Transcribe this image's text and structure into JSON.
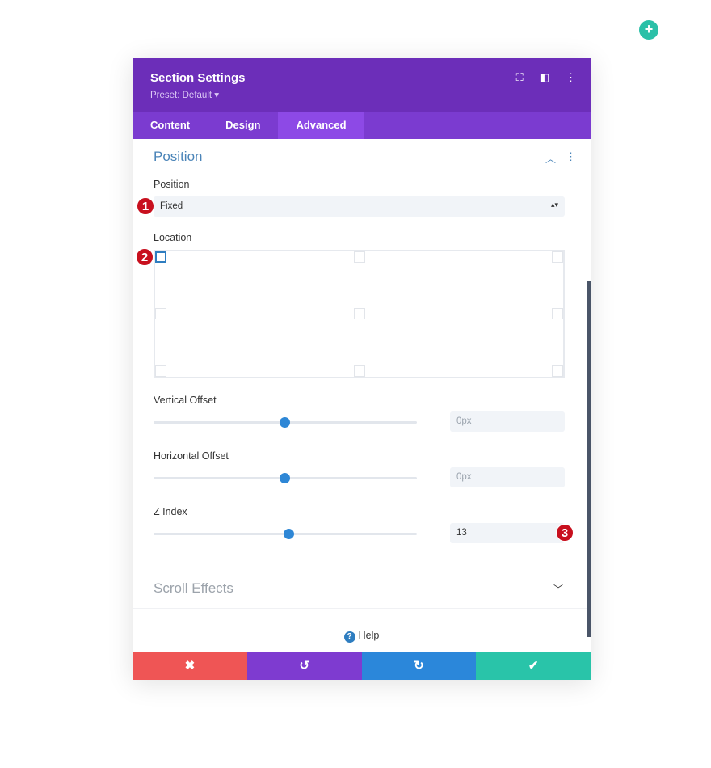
{
  "add_icon": "+",
  "header": {
    "title": "Section Settings",
    "preset": "Preset: Default ▾"
  },
  "tabs": [
    {
      "label": "Content"
    },
    {
      "label": "Design"
    },
    {
      "label": "Advanced"
    }
  ],
  "position_section": {
    "title": "Position",
    "position_label": "Position",
    "position_value": "Fixed",
    "location_label": "Location",
    "location_selected": "top-left",
    "vertical_offset": {
      "label": "Vertical Offset",
      "value": "0px",
      "slider_percent": 50
    },
    "horizontal_offset": {
      "label": "Horizontal Offset",
      "value": "0px",
      "slider_percent": 50
    },
    "z_index": {
      "label": "Z Index",
      "value": "13",
      "slider_percent": 51.5
    }
  },
  "scroll_effects": {
    "title": "Scroll Effects"
  },
  "help": {
    "label": "Help",
    "icon": "?"
  },
  "badges": [
    "1",
    "2",
    "3"
  ],
  "footer": {
    "cancel": "✖",
    "undo": "↺",
    "redo": "↻",
    "save": "✔"
  },
  "colors": {
    "header": "#6c2eb9",
    "tabs": "#7b3bd0",
    "cancel": "#ef5555",
    "undo": "#7e3bd0",
    "redo": "#2b87da",
    "save": "#29c4a9"
  }
}
